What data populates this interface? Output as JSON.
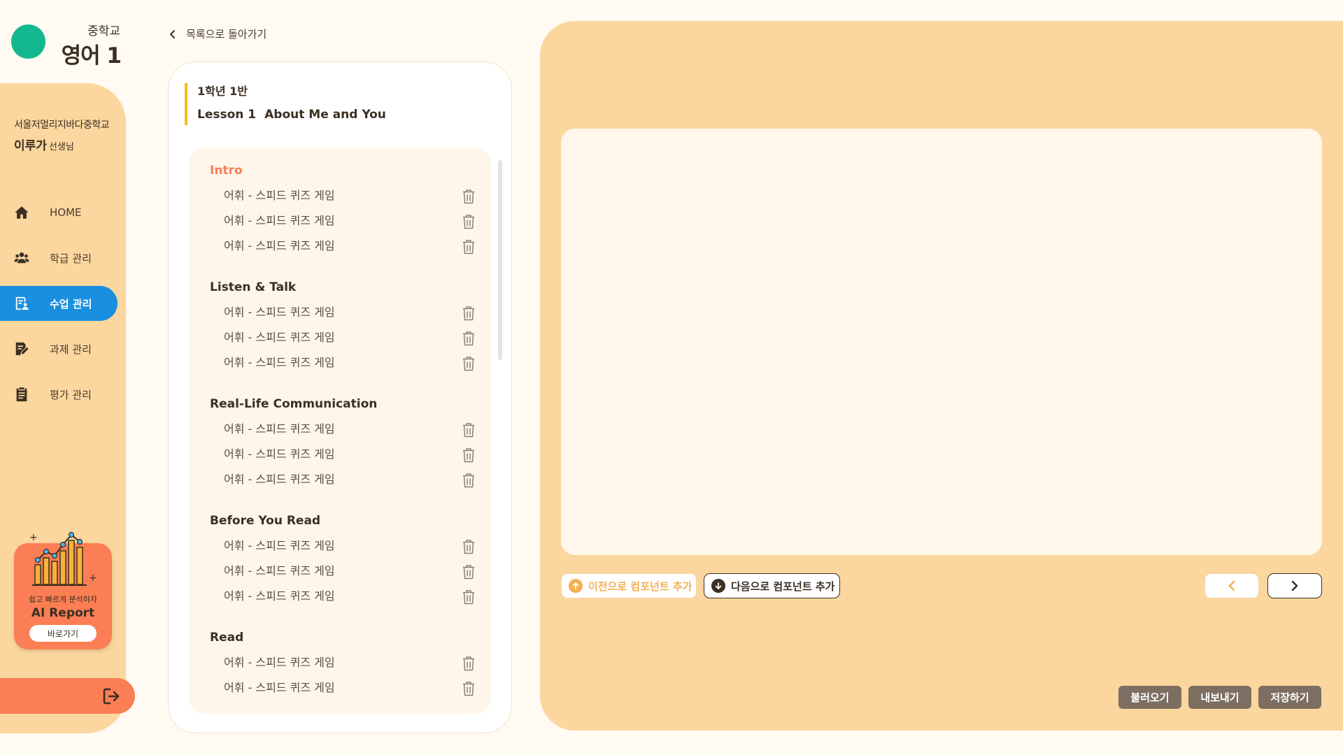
{
  "header": {
    "school_level": "중학교",
    "subject": "영어 1"
  },
  "user": {
    "school": "서울저멀리지바다중학교",
    "name": "이루가",
    "title_suffix": "선생님"
  },
  "nav": [
    {
      "label": "HOME",
      "icon": "home-icon"
    },
    {
      "label": "학급 관리",
      "icon": "users-icon"
    },
    {
      "label": "수업 관리",
      "icon": "lesson-icon",
      "active": true
    },
    {
      "label": "과제 관리",
      "icon": "assignment-icon"
    },
    {
      "label": "평가 관리",
      "icon": "clipboard-icon"
    }
  ],
  "ai_card": {
    "subtitle": "쉽고 빠르게 분석하자",
    "title": "AI Report",
    "button": "바로가기"
  },
  "back_link": "목록으로 돌아가기",
  "lesson": {
    "class_name": "1학년 1반",
    "lesson_no": "Lesson 1",
    "lesson_name": "About Me and You"
  },
  "sections": [
    {
      "title": "Intro",
      "items": [
        "어휘 - 스피드 퀴즈 게임",
        "어휘 - 스피드 퀴즈 게임",
        "어휘 - 스피드 퀴즈 게임"
      ]
    },
    {
      "title": "Listen & Talk",
      "items": [
        "어휘 - 스피드 퀴즈 게임",
        "어휘 - 스피드 퀴즈 게임",
        "어휘 - 스피드 퀴즈 게임"
      ]
    },
    {
      "title": "Real-Life Communication",
      "items": [
        "어휘 - 스피드 퀴즈 게임",
        "어휘 - 스피드 퀴즈 게임",
        "어휘 - 스피드 퀴즈 게임"
      ]
    },
    {
      "title": "Before You Read",
      "items": [
        "어휘 - 스피드 퀴즈 게임",
        "어휘 - 스피드 퀴즈 게임",
        "어휘 - 스피드 퀴즈 게임"
      ]
    },
    {
      "title": "Read",
      "items": [
        "어휘 - 스피드 퀴즈 게임",
        "어휘 - 스피드 퀴즈 게임"
      ]
    }
  ],
  "editor": {
    "add_prev": "이전으로 컴포넌트 추가",
    "add_next": "다음으로 컴포넌트 추가",
    "load": "불러오기",
    "export": "내보내기",
    "save": "저장하기"
  },
  "colors": {
    "accent_green": "#13B88E",
    "sidebar": "#FBD69E",
    "active_blue": "#1A8FE0",
    "orange": "#FB7E54",
    "yellow_bar": "#EFC21E",
    "button_gray": "#7C6E60"
  }
}
